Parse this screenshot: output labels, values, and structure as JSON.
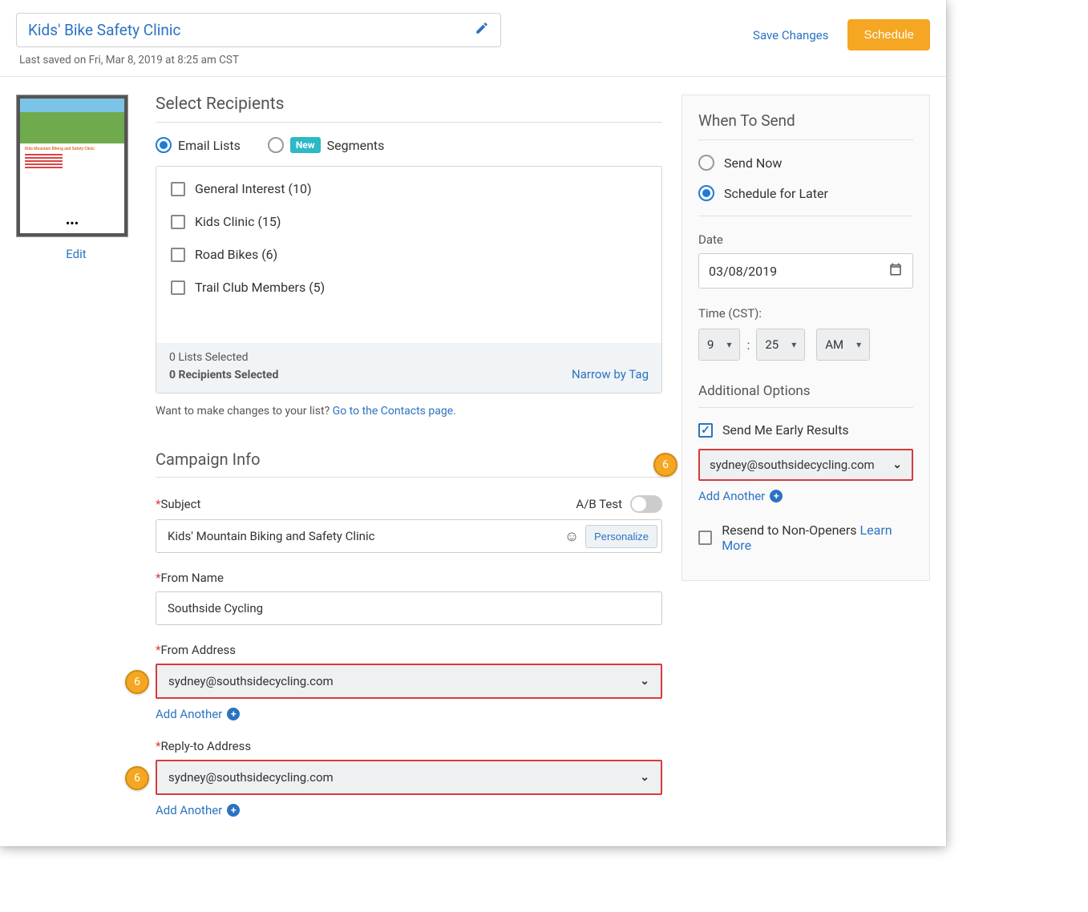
{
  "header": {
    "title": "Kids' Bike Safety Clinic",
    "last_saved": "Last saved on Fri, Mar 8, 2019 at 8:25 am CST",
    "save_changes": "Save Changes",
    "schedule": "Schedule"
  },
  "preview": {
    "edit_label": "Edit",
    "preview_heading": "Kids Mountain Biking and Safety Clinic"
  },
  "recipients": {
    "section_title": "Select Recipients",
    "email_lists_label": "Email Lists",
    "new_badge": "New",
    "segments_label": "Segments",
    "lists": [
      {
        "label": "General Interest (10)"
      },
      {
        "label": "Kids Clinic (15)"
      },
      {
        "label": "Road Bikes (6)"
      },
      {
        "label": "Trail Club Members (5)"
      }
    ],
    "lists_selected": "0 Lists Selected",
    "recipients_selected": "0 Recipients Selected",
    "narrow_by_tag": "Narrow by Tag",
    "helper_prefix": "Want to make changes to your list? ",
    "helper_link": "Go to the Contacts page."
  },
  "campaign": {
    "section_title": "Campaign Info",
    "subject_label": "Subject",
    "abtest_label": "A/B Test",
    "subject_value": "Kids' Mountain Biking and Safety Clinic",
    "personalize_label": "Personalize",
    "from_name_label": "From Name",
    "from_name_value": "Southside Cycling",
    "from_address_label": "From Address",
    "from_address_value": "sydney@southsidecycling.com",
    "reply_to_label": "Reply-to Address",
    "reply_to_value": "sydney@southsidecycling.com",
    "add_another_label": "Add Another"
  },
  "send": {
    "section_title": "When To Send",
    "send_now": "Send Now",
    "schedule_later": "Schedule for Later",
    "date_label": "Date",
    "date_value": "03/08/2019",
    "time_label": "Time (CST):",
    "hour": "9",
    "minute": "25",
    "ampm": "AM",
    "additional_options": "Additional Options",
    "early_results": "Send Me Early Results",
    "early_email": "sydney@southsidecycling.com",
    "add_another": "Add Another",
    "resend_non_openers": "Resend to Non-Openers",
    "learn_more": "Learn More"
  },
  "callout": {
    "num": "6"
  }
}
